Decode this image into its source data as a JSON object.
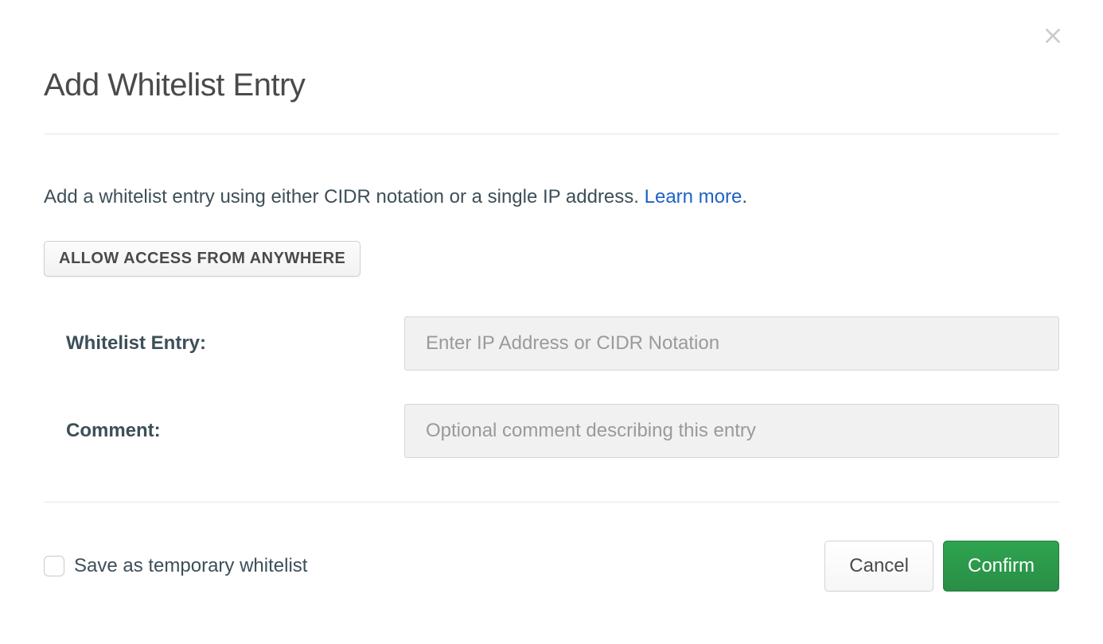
{
  "modal": {
    "title": "Add Whitelist Entry",
    "description_prefix": "Add a whitelist entry using either CIDR notation or a single IP address. ",
    "learn_more_label": "Learn more",
    "description_suffix": ".",
    "allow_anywhere_label": "ALLOW ACCESS FROM ANYWHERE",
    "fields": {
      "whitelist_entry_label": "Whitelist Entry:",
      "whitelist_entry_placeholder": "Enter IP Address or CIDR Notation",
      "whitelist_entry_value": "",
      "comment_label": "Comment:",
      "comment_placeholder": "Optional comment describing this entry",
      "comment_value": ""
    },
    "footer": {
      "temp_whitelist_label": "Save as temporary whitelist",
      "cancel_label": "Cancel",
      "confirm_label": "Confirm"
    }
  }
}
